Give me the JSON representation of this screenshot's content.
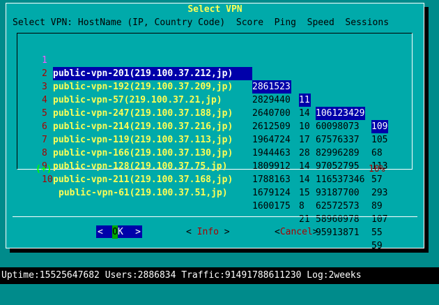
{
  "dialog": {
    "title": "Select VPN",
    "header": "Select VPN: HostName (IP, Country Code)  Score  Ping  Speed  Sessions"
  },
  "list": {
    "rows": [
      {
        "tag": "1",
        "name": "public-vpn-201(219.100.37.212,jp)",
        "score": "2861523",
        "ping": "11",
        "speed": "106123429",
        "sessions": "109"
      },
      {
        "tag": "2",
        "name": "public-vpn-192(219.100.37.209,jp)",
        "score": "2829440",
        "ping": "14",
        "speed": "60098073",
        "sessions": "105"
      },
      {
        "tag": "3",
        "name": "public-vpn-57(219.100.37.21,jp)",
        "score": "2640700",
        "ping": "10",
        "speed": "67576337",
        "sessions": "68"
      },
      {
        "tag": "4",
        "name": "public-vpn-247(219.100.37.188,jp)",
        "score": "2612509",
        "ping": "17",
        "speed": "82996289",
        "sessions": "113"
      },
      {
        "tag": "5",
        "name": "public-vpn-214(219.100.37.216,jp)",
        "score": "1964724",
        "ping": "28",
        "speed": "97052795",
        "sessions": "57"
      },
      {
        "tag": "6",
        "name": "public-vpn-119(219.100.37.113,jp)",
        "score": "1944463",
        "ping": "14",
        "speed": "116537346",
        "sessions": "293"
      },
      {
        "tag": "7",
        "name": "public-vpn-166(219.100.37.130,jp)",
        "score": "1809912",
        "ping": "14",
        "speed": "93187700",
        "sessions": "89"
      },
      {
        "tag": "8",
        "name": "public-vpn-128(219.100.37.75,jp)",
        "score": "1788163",
        "ping": "15",
        "speed": "62572573",
        "sessions": "107"
      },
      {
        "tag": "9",
        "name": "public-vpn-211(219.100.37.168,jp)",
        "score": "1679124",
        "ping": "8",
        "speed": "58960978",
        "sessions": "55"
      },
      {
        "tag": "10",
        "name": "public-vpn-61(219.100.37.51,jp)",
        "score": "1600175",
        "ping": "21",
        "speed": "95913871",
        "sessions": "59"
      }
    ],
    "more_indicator": "(+)",
    "percent": "10%"
  },
  "buttons": {
    "ok_left": "<",
    "ok_hotkey": "O",
    "ok_rest": "K",
    "ok_right": ">",
    "info_left": "<",
    "info_label": " Info ",
    "info_right": ">",
    "cancel_left": "<",
    "cancel_label": "Cancel",
    "cancel_right": ">"
  },
  "statusbar": {
    "text": "Uptime:15525647682 Users:2886834 Traffic:91491788611230 Log:2weeks"
  },
  "colors": {
    "background": "#008b8b",
    "dialog": "#00aaaa",
    "selection": "#0000aa",
    "hostname": "#ffff55",
    "ok_hotkey": "#00aa00"
  }
}
